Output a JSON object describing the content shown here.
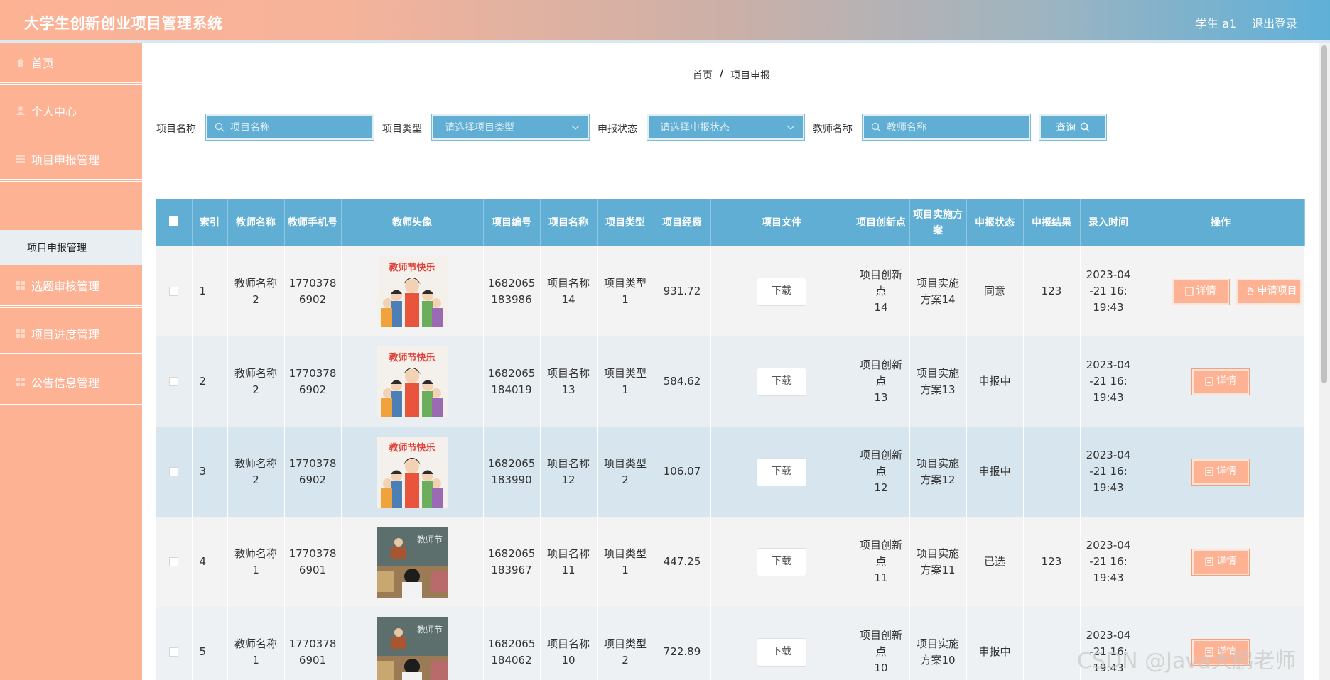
{
  "header": {
    "title": "大学生创新创业项目管理系统",
    "user": "学生 a1",
    "logout": "退出登录"
  },
  "sidebar": {
    "items": [
      {
        "label": "首页",
        "icon": "home-icon"
      },
      {
        "label": "个人中心",
        "icon": "user-icon"
      },
      {
        "label": "项目申报管理",
        "icon": "list-icon"
      },
      {
        "label": "选题审核管理",
        "icon": "grid-icon"
      },
      {
        "label": "项目进度管理",
        "icon": "grid-icon"
      },
      {
        "label": "公告信息管理",
        "icon": "grid-icon"
      }
    ],
    "sub_item": "项目申报管理"
  },
  "breadcrumb": {
    "home": "首页",
    "sep": "/",
    "current": "项目申报"
  },
  "search": {
    "name_label": "项目名称",
    "name_placeholder": "项目名称",
    "type_label": "项目类型",
    "type_placeholder": "请选择项目类型",
    "status_label": "申报状态",
    "status_placeholder": "请选择申报状态",
    "teacher_label": "教师名称",
    "teacher_placeholder": "教师名称",
    "query_button": "查询"
  },
  "table": {
    "headers": {
      "index": "索引",
      "teacher_name": "教师名称",
      "teacher_phone": "教师手机号",
      "teacher_avatar": "教师头像",
      "project_no": "项目编号",
      "project_name": "项目名称",
      "project_type": "项目类型",
      "funds": "项目经费",
      "file": "项目文件",
      "innovation": "项目创新点",
      "plan": "项目实施方案",
      "status": "申报状态",
      "result": "申报结果",
      "time": "录入时间",
      "ops": "操作"
    },
    "download_label": "下载",
    "detail_label": "详情",
    "apply_label": "申请项目",
    "rows": [
      {
        "index": "1",
        "teacher_name": "教师名称2",
        "teacher_phone": "17703786902",
        "project_no": "1682065183986",
        "project_name": "项目名称14",
        "project_type": "项目类型1",
        "funds": "931.72",
        "innovation": "项目创新点14",
        "plan": "项目实施方案14",
        "status": "同意",
        "result": "123",
        "time": "2023-04-21 16:19:43",
        "avatar": "festival"
      },
      {
        "index": "2",
        "teacher_name": "教师名称2",
        "teacher_phone": "17703786902",
        "project_no": "1682065184019",
        "project_name": "项目名称13",
        "project_type": "项目类型1",
        "funds": "584.62",
        "innovation": "项目创新点13",
        "plan": "项目实施方案13",
        "status": "申报中",
        "result": "",
        "time": "2023-04-21 16:19:43",
        "avatar": "festival"
      },
      {
        "index": "3",
        "teacher_name": "教师名称2",
        "teacher_phone": "17703786902",
        "project_no": "1682065183990",
        "project_name": "项目名称12",
        "project_type": "项目类型2",
        "funds": "106.07",
        "innovation": "项目创新点12",
        "plan": "项目实施方案12",
        "status": "申报中",
        "result": "",
        "time": "2023-04-21 16:19:43",
        "avatar": "festival"
      },
      {
        "index": "4",
        "teacher_name": "教师名称1",
        "teacher_phone": "17703786901",
        "project_no": "1682065183967",
        "project_name": "项目名称11",
        "project_type": "项目类型1",
        "funds": "447.25",
        "innovation": "项目创新点11",
        "plan": "项目实施方案11",
        "status": "已选",
        "result": "123",
        "time": "2023-04-21 16:19:43",
        "avatar": "classroom"
      },
      {
        "index": "5",
        "teacher_name": "教师名称1",
        "teacher_phone": "17703786901",
        "project_no": "1682065184062",
        "project_name": "项目名称10",
        "project_type": "项目类型2",
        "funds": "722.89",
        "innovation": "项目创新点10",
        "plan": "项目实施方案10",
        "status": "申报中",
        "result": "",
        "time": "2023-04-21 16:19:43",
        "avatar": "classroom"
      }
    ],
    "avatar_text": {
      "festival": "教师节快乐",
      "classroom": "教师节"
    }
  },
  "watermark": "CSDN @Java大鹏老师",
  "colors": {
    "header_start": "#fdb294",
    "header_end": "#5fb0d8",
    "sidebar": "#fdb294",
    "table_head": "#60aed3",
    "button": "#fdb294"
  }
}
